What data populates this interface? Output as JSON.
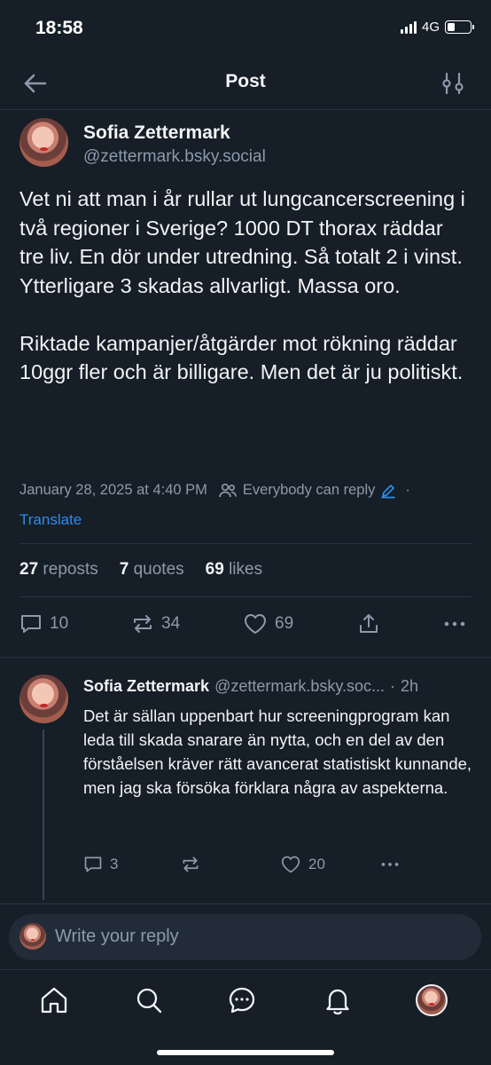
{
  "status_bar": {
    "time": "18:58",
    "network": "4G"
  },
  "header": {
    "title": "Post"
  },
  "post": {
    "author_name": "Sofia Zettermark",
    "author_handle": "@zettermark.bsky.social",
    "text": "Vet ni att man i år rullar ut lungcancerscreening i två regioner i Sverige? 1000 DT thorax räddar tre liv. En dör under utredning. Så totalt 2 i vinst. Ytterligare 3 skadas allvarligt. Massa oro.\n\nRiktade kampanjer/åtgärder mot rökning räddar 10ggr fler och är billigare. Men det är ju politiskt.",
    "timestamp": "January 28, 2025 at 4:40 PM",
    "reply_setting": "Everybody can reply",
    "separator": "·",
    "translate_label": "Translate",
    "stats": {
      "reposts_count": "27",
      "reposts_label": "reposts",
      "quotes_count": "7",
      "quotes_label": "quotes",
      "likes_count": "69",
      "likes_label": "likes"
    },
    "actions": {
      "replies": "10",
      "reposts": "34",
      "likes": "69"
    }
  },
  "reply": {
    "author_name": "Sofia Zettermark",
    "author_handle": "@zettermark.bsky.soc...",
    "separator": "·",
    "time_ago": "2h",
    "text": "Det är sällan uppenbart hur screeningprogram kan leda till skada snarare än nytta, och en del av den förståelsen kräver rätt avancerat statistiskt kunnande, men jag ska försöka förklara några av aspekterna.",
    "actions": {
      "replies": "3",
      "reposts": "",
      "likes": "20"
    }
  },
  "compose": {
    "placeholder": "Write your reply"
  },
  "colors": {
    "background": "#161e27",
    "accent": "#2f8ce8",
    "muted": "#8c9aab"
  }
}
